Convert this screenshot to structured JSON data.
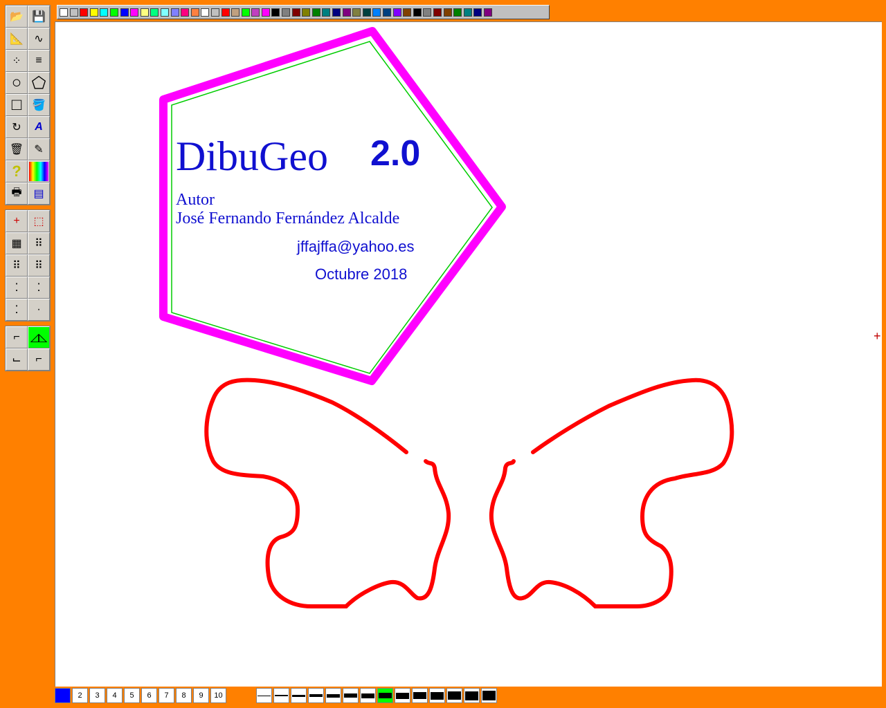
{
  "palette": {
    "colors": [
      "#ffffff",
      "#c0c0c0",
      "#ff0000",
      "#ffff00",
      "#00ffff",
      "#00ff00",
      "#0000ff",
      "#ff00ff",
      "#ffff80",
      "#00ff80",
      "#80ffff",
      "#8080ff",
      "#ff0080",
      "#ff8040",
      "#ffffff",
      "#c0c0c0",
      "#ff0000",
      "#c0a080",
      "#00ff00",
      "#c040c0",
      "#ff00ff",
      "#000000",
      "#808080",
      "#800000",
      "#808000",
      "#008000",
      "#008080",
      "#000080",
      "#800080",
      "#808040",
      "#004040",
      "#0080ff",
      "#004080",
      "#8000ff",
      "#804000",
      "#000000",
      "#808080",
      "#800000",
      "#804000",
      "#008000",
      "#008080",
      "#000080",
      "#800080"
    ]
  },
  "toolbar": {
    "main_tools": [
      {
        "name": "open-icon",
        "glyph": "📂"
      },
      {
        "name": "save-icon",
        "glyph": "💾"
      },
      {
        "name": "ruler-triangle-icon",
        "glyph": "📐"
      },
      {
        "name": "curve-icon",
        "glyph": "∿"
      },
      {
        "name": "points-icon",
        "glyph": "⁘"
      },
      {
        "name": "line-weight-icon",
        "glyph": "≡"
      },
      {
        "name": "circle-icon",
        "glyph": "○"
      },
      {
        "name": "pentagon-icon",
        "glyph": "⬠"
      },
      {
        "name": "rectangle-icon",
        "glyph": "□"
      },
      {
        "name": "fill-bucket-icon",
        "glyph": "🪣"
      },
      {
        "name": "rotate-icon",
        "glyph": "↻"
      },
      {
        "name": "text-icon",
        "glyph": "A"
      },
      {
        "name": "trash-icon",
        "glyph": "🗑"
      },
      {
        "name": "pencil-icon",
        "glyph": "✎"
      },
      {
        "name": "help-icon",
        "glyph": "?"
      },
      {
        "name": "color-spectrum-icon",
        "glyph": ""
      },
      {
        "name": "print-icon",
        "glyph": "🖶"
      },
      {
        "name": "window-icon",
        "glyph": "▤"
      }
    ],
    "grid_tools": [
      {
        "name": "crosshair-icon",
        "glyph": "+"
      },
      {
        "name": "dashed-select-icon",
        "glyph": "⬚"
      },
      {
        "name": "grid-dense-icon",
        "glyph": "▦"
      },
      {
        "name": "grid-dots-dense-icon",
        "glyph": "⠿"
      },
      {
        "name": "grid-dots-medium-icon",
        "glyph": "⠿"
      },
      {
        "name": "grid-dots-medium2-icon",
        "glyph": "⠿"
      },
      {
        "name": "grid-dots-sparse-icon",
        "glyph": "⁚"
      },
      {
        "name": "grid-dots-sparse2-icon",
        "glyph": "⁚"
      },
      {
        "name": "grid-dots-wide-icon",
        "glyph": "⁚"
      },
      {
        "name": "grid-dots-wide2-icon",
        "glyph": "·"
      }
    ],
    "symmetry_tools": [
      {
        "name": "stairs-icon",
        "glyph": "⌐",
        "active": false
      },
      {
        "name": "mirror-vertical-icon",
        "glyph": "◿◺",
        "active": true
      },
      {
        "name": "mirror-down-icon",
        "glyph": "⌙",
        "active": false
      },
      {
        "name": "mirror-diagonal-icon",
        "glyph": "⌐",
        "active": false
      }
    ]
  },
  "canvas": {
    "title": "DibuGeo",
    "version": "2.0",
    "author_label": "Autor",
    "author_name": "José Fernando Fernández Alcalde",
    "email": "jffajffa@yahoo.es",
    "date": "Octubre 2018",
    "colors": {
      "pentagon_outer": "#ff00ff",
      "pentagon_inner": "#00cc00",
      "butterfly": "#ff0000",
      "text": "#1010d0"
    }
  },
  "layers": {
    "items": [
      "",
      "2",
      "3",
      "4",
      "5",
      "6",
      "7",
      "8",
      "9",
      "10"
    ],
    "active_index": 0
  },
  "line_widths": {
    "items": [
      "1",
      "2",
      "3",
      "4",
      "5",
      "6",
      "7",
      "8",
      "9",
      "10",
      "11",
      "12",
      "13",
      "14"
    ],
    "active_index": 7
  }
}
